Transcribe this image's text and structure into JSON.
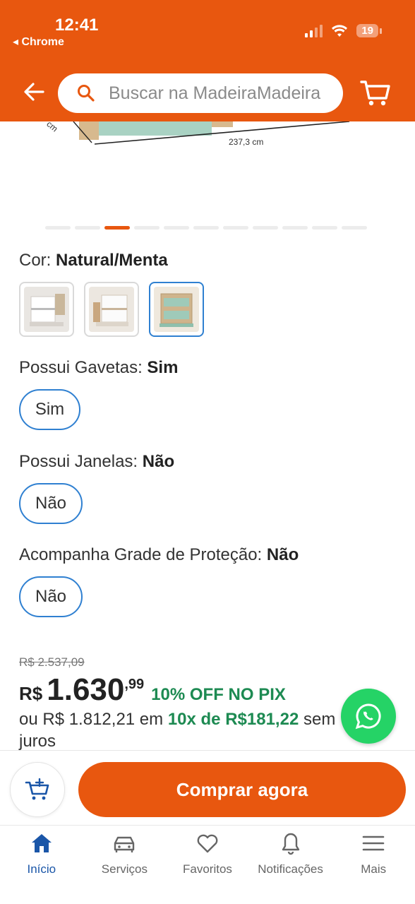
{
  "status_bar": {
    "time": "12:41",
    "back_app": "◂ Chrome",
    "battery": "19"
  },
  "header": {
    "search_placeholder": "Buscar na MadeiraMadeira"
  },
  "product_image": {
    "dimension_width": "237,3 cm",
    "dimension_depth": "cm"
  },
  "options": {
    "color": {
      "label": "Cor: ",
      "value": "Natural/Menta"
    },
    "drawers": {
      "label": "Possui Gavetas: ",
      "value": "Sim",
      "pill": "Sim"
    },
    "windows": {
      "label": "Possui Janelas: ",
      "value": "Não",
      "pill": "Não"
    },
    "guard": {
      "label": "Acompanha Grade de Proteção: ",
      "value": "Não",
      "pill": "Não"
    }
  },
  "price": {
    "old": "R$ 2.537,09",
    "currency": "R$",
    "main": "1.630",
    "cents": ",99",
    "pix": "10% OFF NO PIX",
    "installments_prefix": "ou R$ 1.812,21 em ",
    "installments_highlight": "10x de R$181,22",
    "installments_suffix": " sem juros"
  },
  "actions": {
    "buy_label": "Comprar agora"
  },
  "tabs": [
    {
      "label": "Início",
      "icon": "home-icon",
      "active": true
    },
    {
      "label": "Serviços",
      "icon": "car-icon",
      "active": false
    },
    {
      "label": "Favoritos",
      "icon": "heart-icon",
      "active": false
    },
    {
      "label": "Notificações",
      "icon": "bell-icon",
      "active": false
    },
    {
      "label": "Mais",
      "icon": "menu-icon",
      "active": false
    }
  ],
  "colors": {
    "brand": "#e8570f",
    "selected": "#2f80d1",
    "pix_green": "#1d8a52",
    "whatsapp": "#25d366",
    "tab_active": "#1a56a8"
  }
}
